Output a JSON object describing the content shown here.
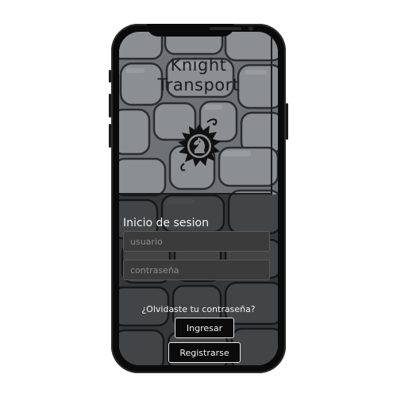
{
  "app": {
    "title_line1": "Knight",
    "title_line2": "Transport",
    "logo_icon": "knight-chess-piece-crest-icon"
  },
  "login": {
    "heading": "Inicio de sesion",
    "username_placeholder": "usuario",
    "password_placeholder": "contraseña",
    "forgot_link": "¿Olvidaste tu contraseña?",
    "login_button": "Ingresar",
    "register_button": "Registrarse"
  },
  "colors": {
    "background": "#ffffff",
    "phone_frame": "#0a0a0a",
    "stone": "#6f7275",
    "field_background": "#3b3b3b",
    "button_background": "#0b0b0b",
    "button_border": "#e8e8e8",
    "text_light": "#f2f2f2",
    "title_text": "#1c1c1c"
  }
}
